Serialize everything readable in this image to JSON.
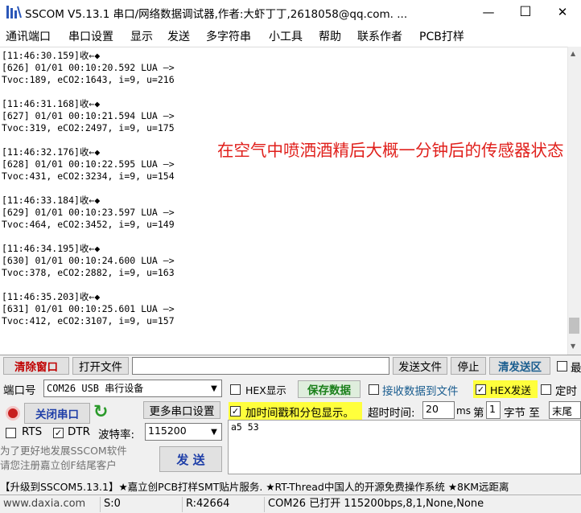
{
  "window": {
    "title": "SSCOM V5.13.1 串口/网络数据调试器,作者:大虾丁丁,2618058@qq.com. ...",
    "minimize_glyph": "—",
    "maximize_glyph": "☐",
    "close_glyph": "✕"
  },
  "menu": [
    "通讯端口",
    "串口设置",
    "显示",
    "发送",
    "多字符串",
    "小工具",
    "帮助",
    "联系作者",
    "PCB打样"
  ],
  "receive": {
    "lines": "[11:46:30.159]收←◆\n[626] 01/01 00:10:20.592 LUA —>\nTvoc:189, eCO2:1643, i=9, u=216\n\n[11:46:31.168]收←◆\n[627] 01/01 00:10:21.594 LUA —>\nTvoc:319, eCO2:2497, i=9, u=175\n\n[11:46:32.176]收←◆\n[628] 01/01 00:10:22.595 LUA —>\nTvoc:431, eCO2:3234, i=9, u=154\n\n[11:46:33.184]收←◆\n[629] 01/01 00:10:23.597 LUA —>\nTvoc:464, eCO2:3452, i=9, u=149\n\n[11:46:34.195]收←◆\n[630] 01/01 00:10:24.600 LUA —>\nTvoc:378, eCO2:2882, i=9, u=163\n\n[11:46:35.203]收←◆\n[631] 01/01 00:10:25.601 LUA —>\nTvoc:412, eCO2:3107, i=9, u=157",
    "annotation": "在空气中喷洒酒精后大概一分钟后的传感器状态",
    "scroll_up": "▲",
    "scroll_down": "▼"
  },
  "toolbar": {
    "clear_window": "清除窗口",
    "open_file": "打开文件",
    "file_path": "",
    "send_file": "发送文件",
    "stop": "停止",
    "clear_send": "清发送区",
    "last_label": "最"
  },
  "port": {
    "port_label": "端口号",
    "port_value": "COM26 USB 串行设备",
    "more_settings": "更多串口设置",
    "close_port": "关闭串口",
    "refresh_glyph": "↻",
    "rts": "RTS",
    "dtr": "DTR",
    "dtr_checked": "✓",
    "baud_label": "波特率:",
    "baud_value": "115200",
    "promo": "为了更好地发展SSCOM软件\n请您注册嘉立创F结尾客户",
    "combo_arrow": "▼"
  },
  "options": {
    "hex_display": "HEX显示",
    "save_data": "保存数据",
    "recv_to_file": "接收数据到文件",
    "hex_send": "HEX发送",
    "hex_send_checked": "✓",
    "timer_send": "定时",
    "timestamp": "加时间戳和分包显示。",
    "timestamp_checked": "✓",
    "timeout_label": "超时时间:",
    "timeout_value": "20",
    "ms": "ms",
    "di": "第",
    "byte_index": "1",
    "byte_label": "字节 至",
    "byte_end": "末尾"
  },
  "send": {
    "text": "a5 53",
    "button": "发 送"
  },
  "ticker": "【升级到SSCOM5.13.1】★嘉立创PCB打样SMT贴片服务. ★RT-Thread中国人的开源免费操作系统 ★8KM远距离",
  "status": {
    "website": "www.daxia.com",
    "sent": "S:0",
    "received": "R:42664",
    "port_state": "COM26 已打开  115200bps,8,1,None,None"
  },
  "colors": {
    "annotation": "#e0201c",
    "clear_red": "#c00000",
    "highlight_yellow": "#ffff3c",
    "ticker_blue": "#0000cc"
  }
}
